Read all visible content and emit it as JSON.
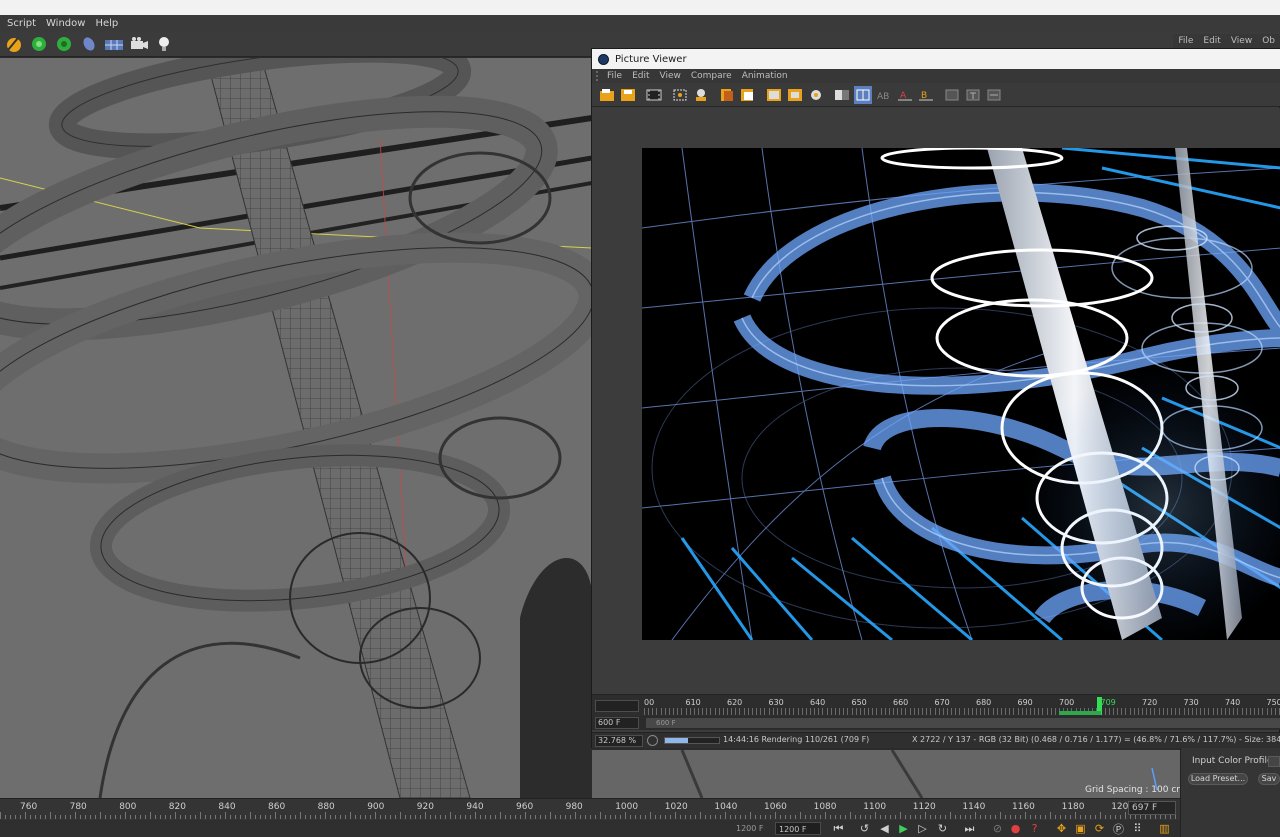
{
  "menubar": {
    "items": [
      "Script",
      "Window",
      "Help"
    ]
  },
  "toolbar": {
    "icons": [
      "pen-tool-icon",
      "sphere-primitive-icon",
      "gear-generator-icon",
      "deformer-icon",
      "floor-icon",
      "camera-icon",
      "light-icon"
    ]
  },
  "right_menu": {
    "items": [
      "File",
      "Edit",
      "View",
      "Ob"
    ]
  },
  "viewport": {
    "grid_spacing": "Grid Spacing : 100 cm"
  },
  "timeline": {
    "ticks": [
      "760",
      "780",
      "800",
      "820",
      "840",
      "860",
      "880",
      "900",
      "920",
      "940",
      "960",
      "980",
      "1000",
      "1020",
      "1040",
      "1060",
      "1080",
      "1100",
      "1120",
      "1140",
      "1160",
      "1180",
      "120"
    ],
    "current_frame": "697 F"
  },
  "transport": {
    "field_left": "1200 F",
    "field_right": "1200 F"
  },
  "attributes": {
    "input_color_profile": "Input Color Profile .",
    "load_preset": "Load Preset...",
    "save": "Sav"
  },
  "picture_viewer": {
    "title": "Picture Viewer",
    "menu": [
      "File",
      "Edit",
      "View",
      "Compare",
      "Animation"
    ],
    "ruler_ticks": [
      "00",
      "610",
      "620",
      "630",
      "640",
      "650",
      "660",
      "670",
      "680",
      "690",
      "700",
      "709",
      "720",
      "730",
      "740",
      "750"
    ],
    "frame_field": "600 F",
    "range_label": "600 F",
    "zoom": "32.768 %",
    "render_status": "14:44:16 Rendering 110/261 (709 F)",
    "pixel_info": "X 2722 / Y 137 - RGB (32 Bit) (0.468 / 0.716 / 1.177) = (46.8% / 71.6% / 117.7%) - Size: 3840x2160, RGB (32 B",
    "render_progress": 0.42
  },
  "colors": {
    "accent_blue": "#5aa0ff",
    "playhead_green": "#33dd55",
    "wire_grey": "#444444",
    "viewport_bg": "#6e6e6e"
  }
}
